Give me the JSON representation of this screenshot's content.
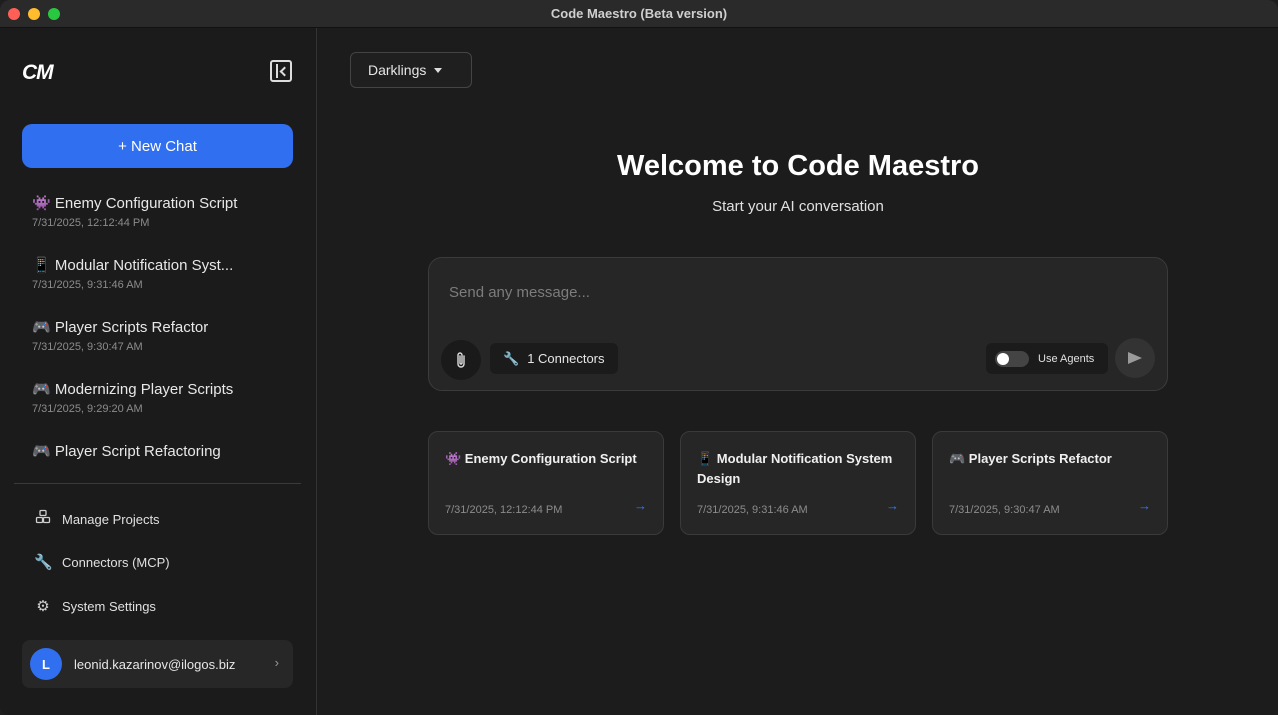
{
  "window": {
    "title": "Code Maestro (Beta version)"
  },
  "sidebar": {
    "logo": "CM",
    "new_chat_label": "+ New Chat",
    "chats": [
      {
        "icon": "👾",
        "title": "Enemy Configuration Script",
        "date": "7/31/2025, 12:12:44 PM"
      },
      {
        "icon": "📱",
        "title": "Modular Notification Syst...",
        "date": "7/31/2025, 9:31:46 AM"
      },
      {
        "icon": "🎮",
        "title": "Player Scripts Refactor",
        "date": "7/31/2025, 9:30:47 AM"
      },
      {
        "icon": "🎮",
        "title": "Modernizing Player Scripts",
        "date": "7/31/2025, 9:29:20 AM"
      },
      {
        "icon": "🎮",
        "title": "Player Script Refactoring",
        "date": ""
      }
    ],
    "nav": {
      "manage_projects": "Manage Projects",
      "connectors": "Connectors (MCP)",
      "settings": "System Settings"
    },
    "user": {
      "initial": "L",
      "email": "leonid.kazarinov@ilogos.biz"
    }
  },
  "main": {
    "project": "Darklings",
    "welcome": "Welcome to Code Maestro",
    "subtitle": "Start your AI conversation",
    "composer": {
      "placeholder": "Send any message...",
      "connectors_label": "1 Connectors",
      "agents_label": "Use Agents",
      "agents_enabled": false
    },
    "cards": [
      {
        "title": "👾 Enemy Configuration Script",
        "date": "7/31/2025, 12:12:44 PM"
      },
      {
        "title": "📱 Modular Notification System Design",
        "date": "7/31/2025, 9:31:46 AM"
      },
      {
        "title": "🎮 Player Scripts Refactor",
        "date": "7/31/2025, 9:30:47 AM"
      }
    ]
  },
  "colors": {
    "accent": "#2f6ff0",
    "link_arrow": "#3b7be6"
  }
}
